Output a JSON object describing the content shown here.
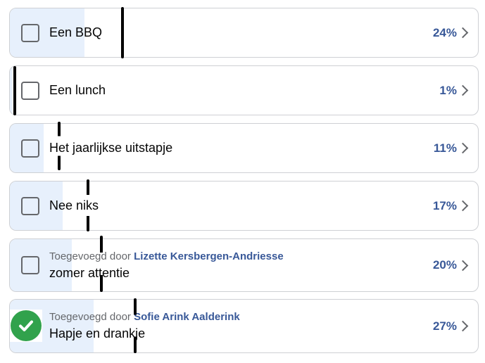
{
  "poll": {
    "options": [
      {
        "label": "Een BBQ",
        "percent_text": "24%",
        "percent": 24,
        "added_prefix": "",
        "added_by": "",
        "selected": false
      },
      {
        "label": "Een lunch",
        "percent_text": "1%",
        "percent": 1,
        "added_prefix": "",
        "added_by": "",
        "selected": false
      },
      {
        "label": "Het jaarlijkse uitstapje",
        "percent_text": "11%",
        "percent": 11,
        "added_prefix": "",
        "added_by": "",
        "selected": false
      },
      {
        "label": "Nee niks",
        "percent_text": "17%",
        "percent": 17,
        "added_prefix": "",
        "added_by": "",
        "selected": false
      },
      {
        "label": "zomer attentie",
        "percent_text": "20%",
        "percent": 20,
        "added_prefix": "Toegevoegd door",
        "added_by": "Lizette Kersbergen-Andriesse",
        "selected": false
      },
      {
        "label": "Hapje en drankje",
        "percent_text": "27%",
        "percent": 27,
        "added_prefix": "Toegevoegd door",
        "added_by": "Sofie Arink Aalderink",
        "selected": true
      }
    ]
  },
  "colors": {
    "accent": "#385898",
    "fill": "#e7f0fc",
    "check": "#31a24c",
    "border": "#ced0d4",
    "marker": "#000000"
  },
  "icons": {
    "checkbox": "checkbox-icon",
    "selected": "check-circle-icon",
    "chevron": "chevron-right-icon"
  }
}
